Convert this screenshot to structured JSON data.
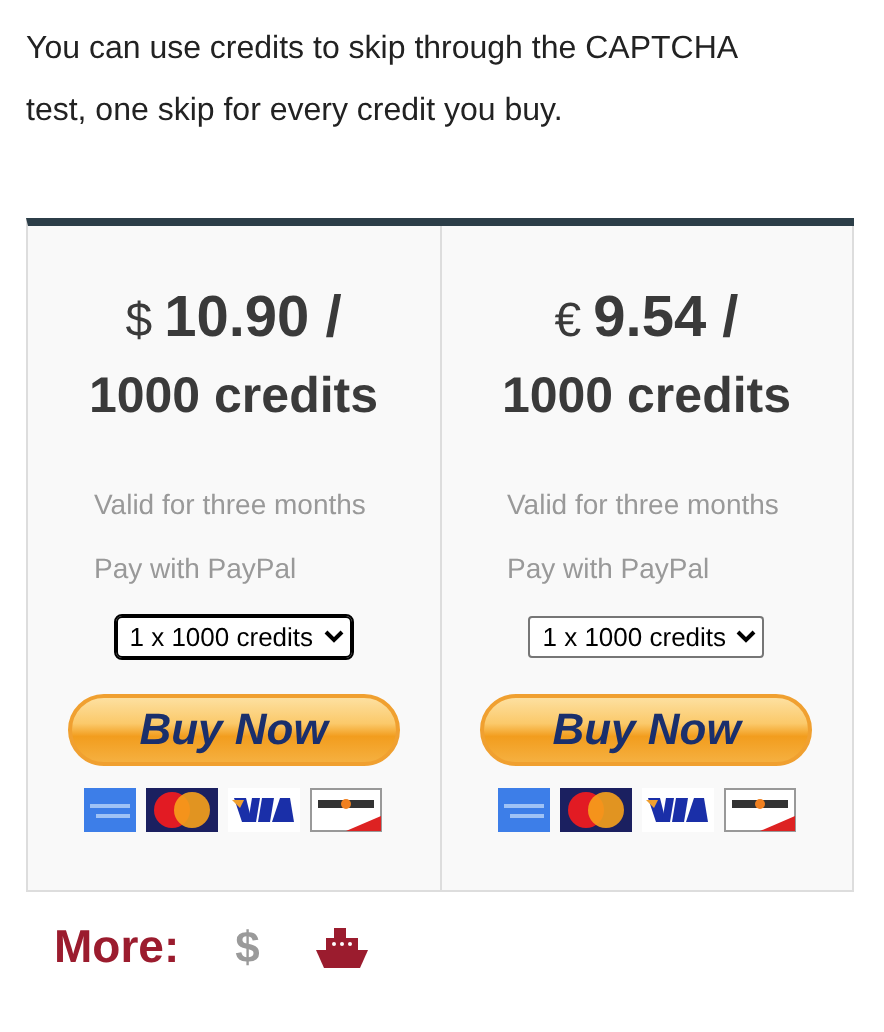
{
  "intro": "You can use credits to skip through the CAPTCHA test, one skip for every credit you buy.",
  "plans": [
    {
      "currency": "$",
      "price": "10.90 /",
      "amount": "1000 credits",
      "notes": [
        "Valid for three months",
        "Pay with PayPal"
      ],
      "select": {
        "value": "1 x 1000 credits",
        "focused": true
      },
      "button": "Buy Now"
    },
    {
      "currency": "€",
      "price": "9.54 /",
      "amount": "1000 credits",
      "notes": [
        "Valid for three months",
        "Pay with PayPal"
      ],
      "select": {
        "value": "1 x 1000 credits",
        "focused": false
      },
      "button": "Buy Now"
    }
  ],
  "more": {
    "label": "More:",
    "links": [
      {
        "kind": "glyph",
        "text": "$",
        "disabled": true
      },
      {
        "kind": "ship",
        "disabled": false
      }
    ]
  }
}
